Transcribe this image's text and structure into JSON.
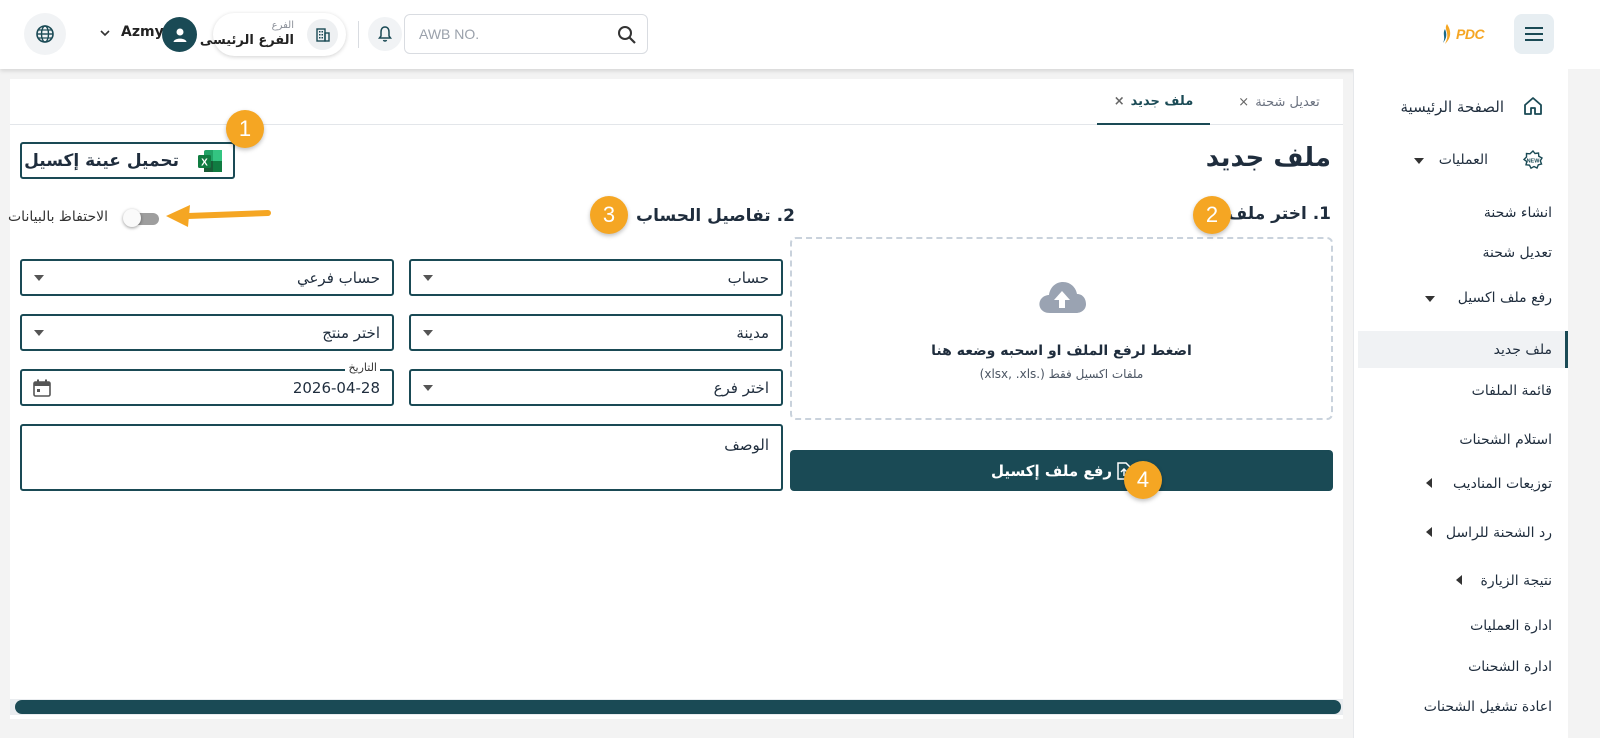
{
  "header": {
    "username": "Azmy",
    "branch_small_label": "الفرع",
    "branch_name": "الفرع الرئيسى",
    "search_placeholder": "AWB NO.",
    "logo_text": "PDC"
  },
  "sidebar": {
    "items": [
      {
        "label": "الصفحة الرئيسية"
      },
      {
        "label": "العمليات"
      },
      {
        "label": "انشاء شحنة"
      },
      {
        "label": "تعديل شحنة"
      },
      {
        "label": "رفع ملف اكسيل"
      },
      {
        "label": "ملف جديد"
      },
      {
        "label": "قائمة الملفات"
      },
      {
        "label": "استلام الشحنات"
      },
      {
        "label": "توزيعات المناديب"
      },
      {
        "label": "رد الشحنة للراسل"
      },
      {
        "label": "نتيجة الزيارة"
      },
      {
        "label": "ادارة العمليات"
      },
      {
        "label": "ادارة الشحنات"
      },
      {
        "label": "اعادة تشغيل الشحنات"
      }
    ]
  },
  "tabs": [
    {
      "label": "ملف جديد",
      "close": "×"
    },
    {
      "label": "تعديل شحنة",
      "close": "×"
    }
  ],
  "page": {
    "title": "ملف جديد",
    "sample_button": "تحميل عينة إكسيل",
    "section1_title": "1. اختر ملف",
    "section2_title": "2. تفاصيل الحساب",
    "dropzone_main": "اضغط لرفع الملف او اسحبه وضعه هنا",
    "dropzone_sub": "ملفات اكسيل فقط (.xlsx, .xls)",
    "upload_button": "رفع ملف إكسيل",
    "keep_data_label": "الاحتفاظ بالبيانات"
  },
  "form": {
    "account": "حساب",
    "sub_account": "حساب فرعي",
    "city": "مدينة",
    "product": "اختر منتج",
    "branch": "اختر فرع",
    "date_label": "التاريخ",
    "date_value": "2026-04-28",
    "description": "الوصف"
  },
  "annotations": [
    "1",
    "2",
    "3",
    "4"
  ],
  "colors": {
    "primary": "#1a4a55",
    "badge": "#f5a623",
    "excel_green": "#1d7044"
  }
}
